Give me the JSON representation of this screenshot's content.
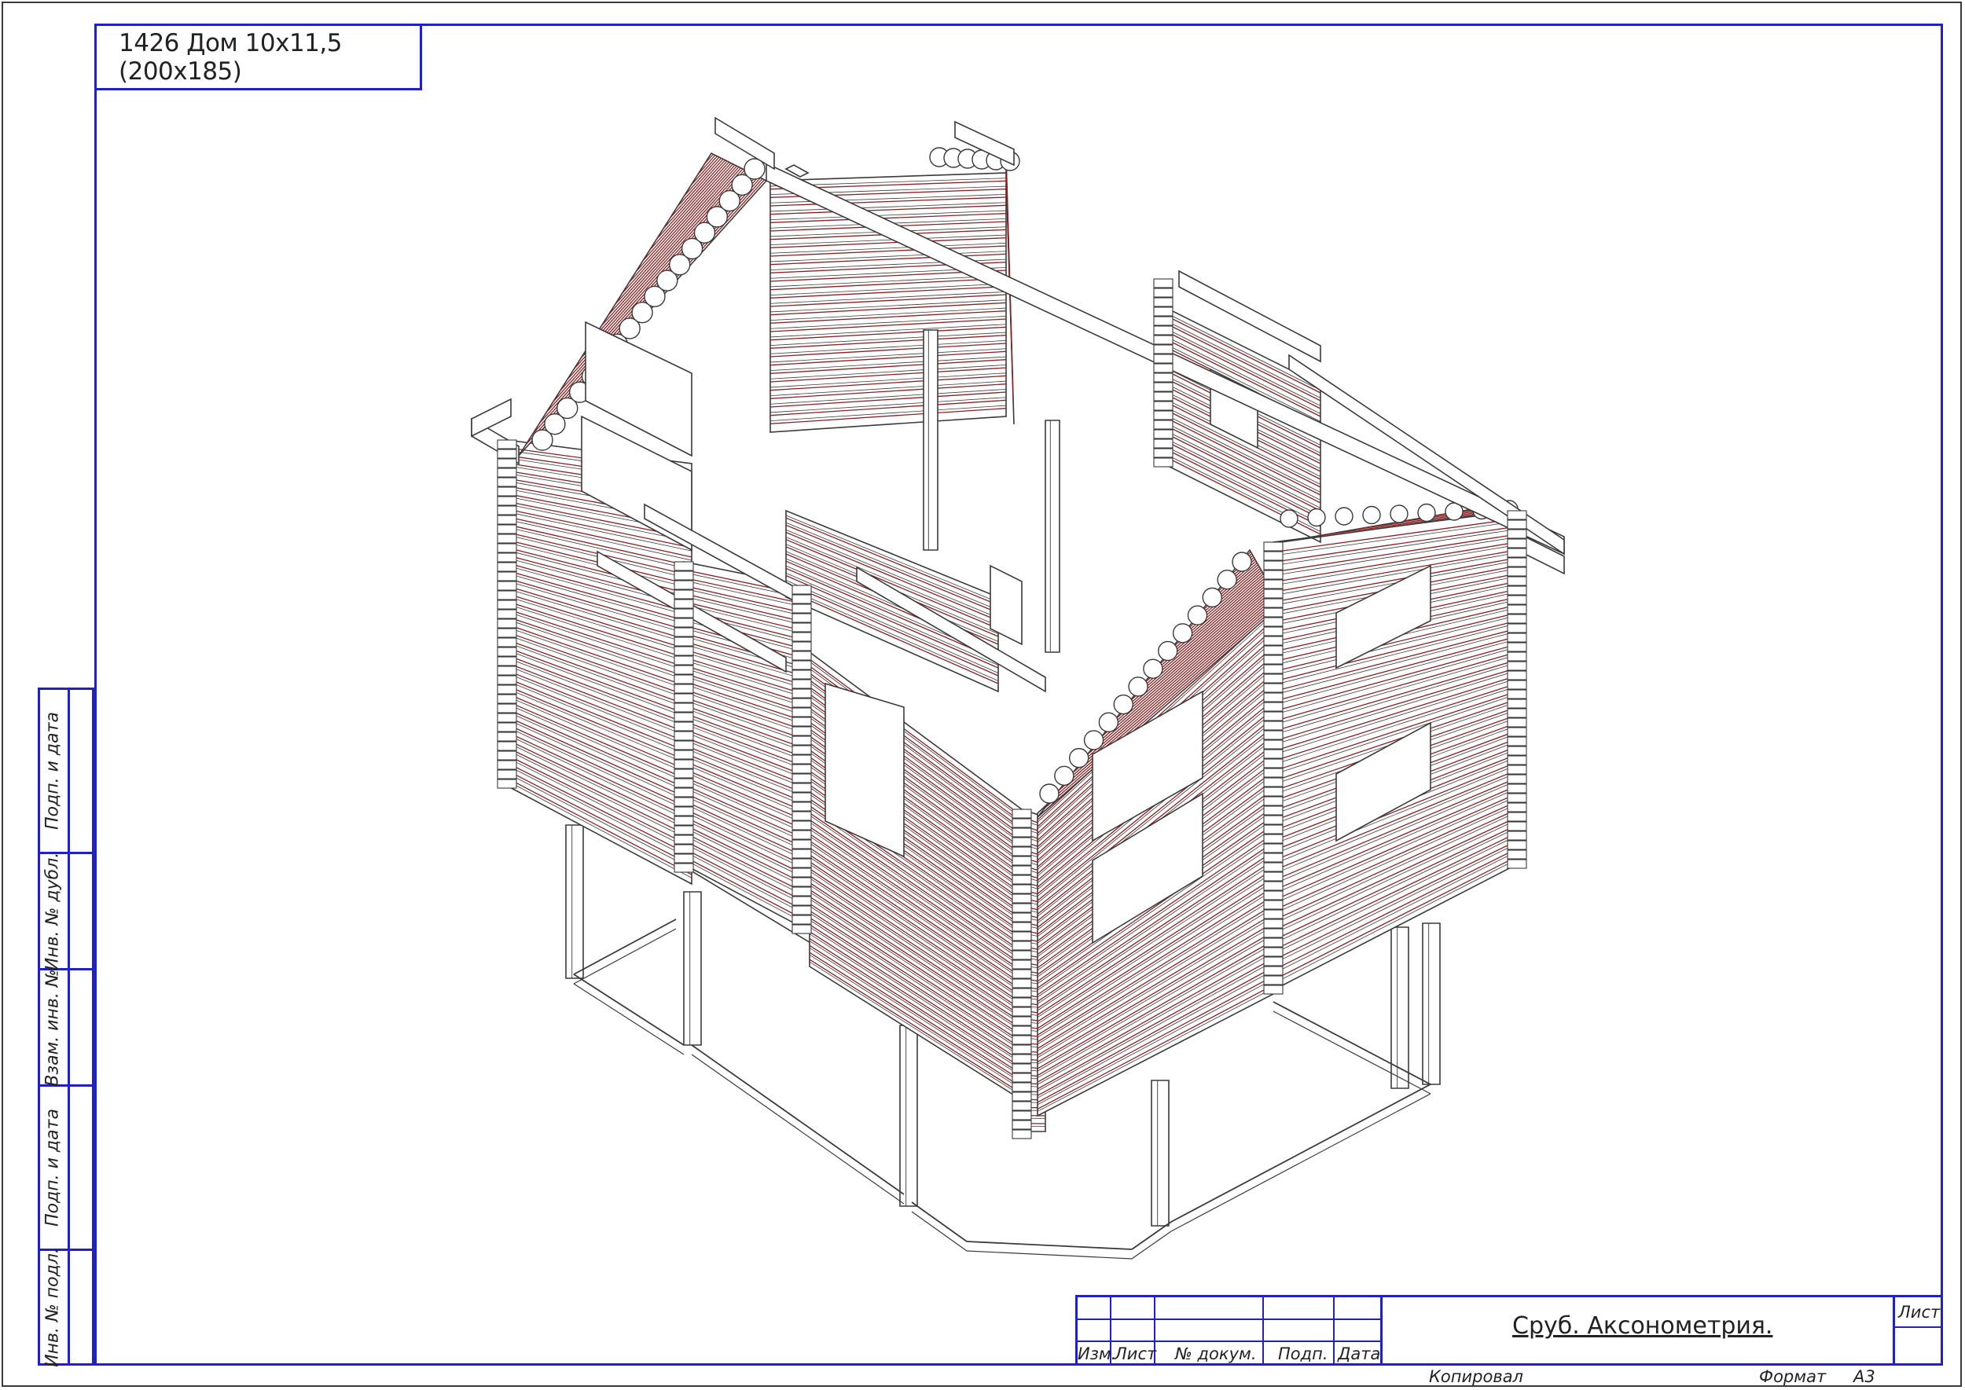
{
  "title": "1426 Дом 10х11,5 (200х185)",
  "side_labels": [
    "Подп. и дата",
    "Инв. № дубл.",
    "Взам. инв. №",
    "Подп. и дата",
    "Инв. № подл."
  ],
  "stamp": {
    "col_izm": "Изм.",
    "col_list": "Лист",
    "col_ndoc": "№ докум.",
    "col_podp": "Подп.",
    "col_data": "Дата",
    "document_title": "Сруб. Аксонометрия.",
    "sheet_label": "Лист"
  },
  "footer": {
    "copied": "Копировал",
    "format_label": "Формат",
    "format_value": "А3"
  },
  "colors": {
    "frame": "#2020c8",
    "log_outline": "#3a3a3a",
    "log_hatch": "#8a2020"
  }
}
